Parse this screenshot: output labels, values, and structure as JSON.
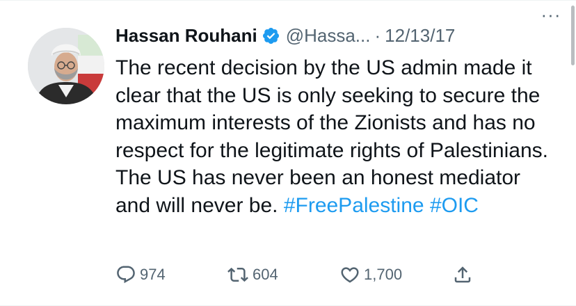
{
  "tweet": {
    "author": {
      "display_name": "Hassan Rouhani",
      "handle": "@Hassa...",
      "verified": true,
      "avatar_icon": "profile-photo"
    },
    "separator": "·",
    "date": "12/13/17",
    "more_label": "···",
    "text_main": "The recent decision by the US admin made it clear that the US is only seeking to secure the maximum interests of the Zionists and has no respect for the legitimate rights of Palestinians. The US has never been an honest mediator and will never be. ",
    "hashtags": [
      "#FreePalestine",
      "#OIC"
    ],
    "metrics": {
      "replies": "974",
      "retweets": "604",
      "likes": "1,700"
    },
    "icons": {
      "reply": "reply-icon",
      "retweet": "retweet-icon",
      "like": "heart-icon",
      "share": "share-icon",
      "verified": "verified-badge-icon",
      "more": "more-options-icon"
    },
    "colors": {
      "text": "#0f1419",
      "secondary": "#536471",
      "accent": "#1d9bf0"
    }
  }
}
